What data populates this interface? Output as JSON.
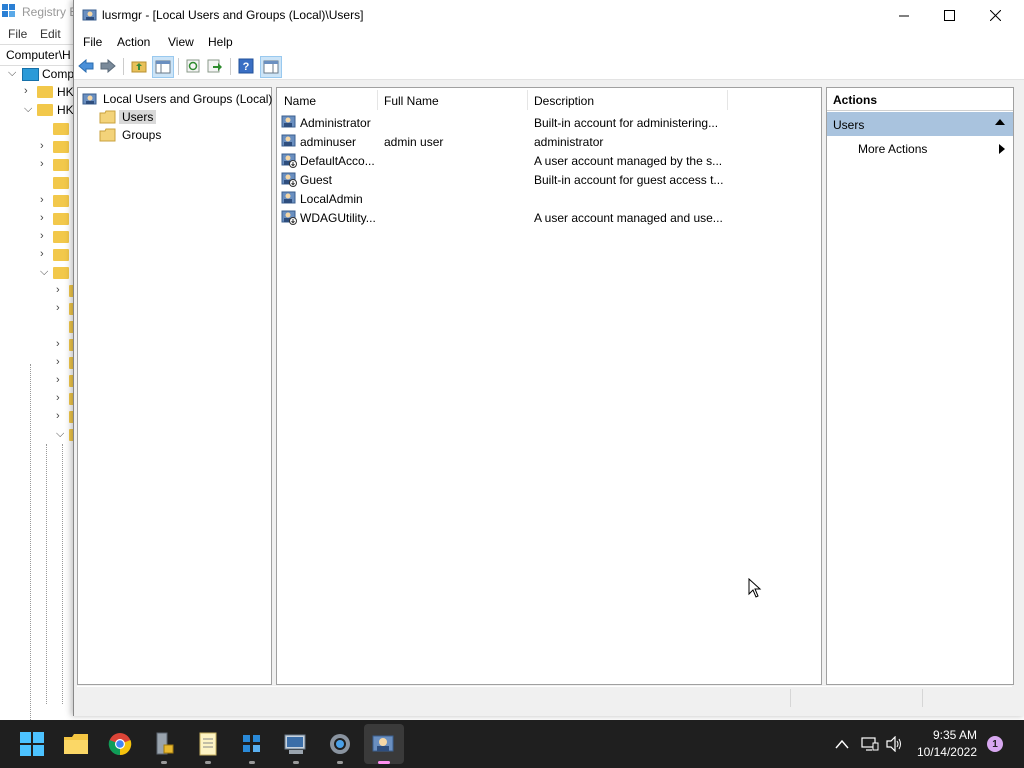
{
  "background_app": {
    "title": "Registry E",
    "menu": [
      "File",
      "Edit"
    ],
    "address": "Computer\\H",
    "tree": [
      {
        "label": "Comp",
        "chevron": "v"
      },
      {
        "label": "HK",
        "chevron": ">"
      },
      {
        "label": "HK",
        "chevron": "v"
      }
    ]
  },
  "window": {
    "title": "lusrmgr - [Local Users and Groups (Local)\\Users]",
    "controls": {
      "minimize": "—",
      "maximize": "☐",
      "close": "✕"
    }
  },
  "menu": {
    "file": "File",
    "action": "Action",
    "view": "View",
    "help": "Help"
  },
  "tree": {
    "root": "Local Users and Groups (Local)",
    "users": "Users",
    "groups": "Groups"
  },
  "list": {
    "columns": {
      "name": "Name",
      "full_name": "Full Name",
      "description": "Description"
    },
    "rows": [
      {
        "name": "Administrator",
        "full_name": "",
        "description": "Built-in account for administering..."
      },
      {
        "name": "adminuser",
        "full_name": "admin user",
        "description": "administrator"
      },
      {
        "name": "DefaultAcco...",
        "full_name": "",
        "description": "A user account managed by the s..."
      },
      {
        "name": "Guest",
        "full_name": "",
        "description": "Built-in account for guest access t..."
      },
      {
        "name": "LocalAdmin",
        "full_name": "",
        "description": ""
      },
      {
        "name": "WDAGUtility...",
        "full_name": "",
        "description": "A user account managed and use..."
      }
    ]
  },
  "actions": {
    "header": "Actions",
    "section": "Users",
    "more": "More Actions"
  },
  "taskbar": {
    "time": "9:35 AM",
    "date": "10/14/2022",
    "notification_count": "1"
  },
  "colors": {
    "accent": "#0078d4",
    "actions_section": "#a9c3de",
    "selection": "#d9d9d9",
    "taskbar": "#1f1f1f"
  }
}
